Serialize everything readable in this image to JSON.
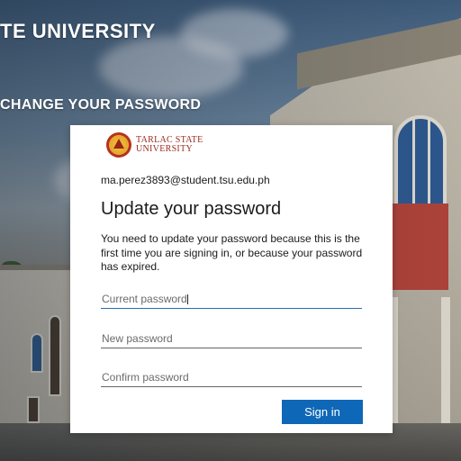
{
  "background": {
    "heading_partial": "TE UNIVERSITY",
    "subheading_partial": "CHANGE YOUR PASSWORD"
  },
  "dialog": {
    "logo": {
      "line1": "TARLAC STATE",
      "line2": "UNIVERSITY"
    },
    "account_email": "ma.perez3893@student.tsu.edu.ph",
    "title": "Update your password",
    "description": "You need to update your password because this is the first time you are signing in, or because your password has expired.",
    "fields": {
      "current_placeholder": "Current password",
      "new_placeholder": "New password",
      "confirm_placeholder": "Confirm password"
    },
    "sign_in_label": "Sign in"
  },
  "colors": {
    "button_primary": "#0f67b7",
    "logo_text": "#9b2b1f"
  },
  "icons": {
    "logo": "tsu-seal-icon"
  }
}
